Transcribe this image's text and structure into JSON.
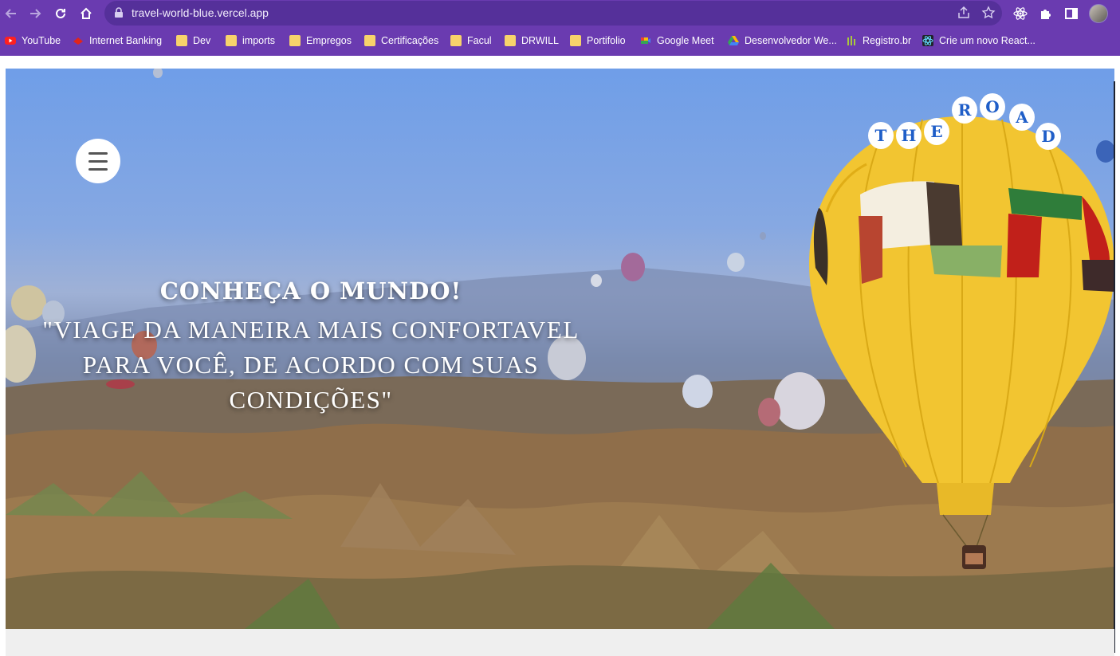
{
  "browser": {
    "url": "travel-world-blue.vercel.app",
    "bookmarks": [
      {
        "label": "YouTube",
        "icon": "youtube-icon"
      },
      {
        "label": "Internet Banking",
        "icon": "bank-icon"
      },
      {
        "label": "Dev",
        "icon": "folder-icon"
      },
      {
        "label": "imports",
        "icon": "folder-icon"
      },
      {
        "label": "Empregos",
        "icon": "folder-icon"
      },
      {
        "label": "Certificações",
        "icon": "folder-icon"
      },
      {
        "label": "Facul",
        "icon": "folder-icon"
      },
      {
        "label": "DRWILL",
        "icon": "folder-icon"
      },
      {
        "label": "Portifolio",
        "icon": "folder-icon"
      },
      {
        "label": "Google Meet",
        "icon": "google-meet-icon"
      },
      {
        "label": "Desenvolvedor We...",
        "icon": "google-drive-icon"
      },
      {
        "label": "Registro.br",
        "icon": "registro-icon"
      },
      {
        "label": "Crie um novo React...",
        "icon": "react-icon"
      }
    ]
  },
  "hero": {
    "title": "CONHEÇA O MUNDO!",
    "subtitle": "\"VIAGE DA MANEIRA MAIS CONFORTAVEL PARA VOCÊ, DE ACORDO COM SUAS CONDIÇÕES\"",
    "logo_letters": [
      "T",
      "H",
      "E",
      "R",
      "O",
      "A",
      "D"
    ]
  },
  "colors": {
    "chrome": "#6a3bb0",
    "omnibox": "#55309a",
    "logo_text": "#1f5ec8",
    "balloon": "#f2c531"
  }
}
